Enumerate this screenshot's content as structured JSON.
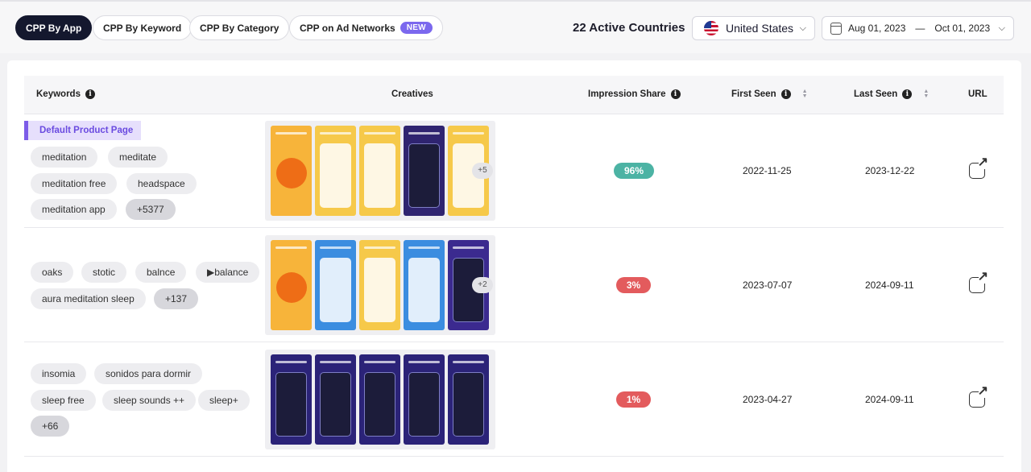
{
  "tabs": [
    {
      "label": "CPP By App"
    },
    {
      "label": "CPP By Keyword"
    },
    {
      "label": "CPP By Category"
    },
    {
      "label": "CPP on Ad Networks",
      "badge": "NEW"
    }
  ],
  "countries_label": "22 Active Countries",
  "country": "United States",
  "date_range": {
    "start": "Aug 01, 2023",
    "separator": "—",
    "end": "Oct 01, 2023"
  },
  "columns": {
    "keywords": "Keywords",
    "creatives": "Creatives",
    "impression_share": "Impression Share",
    "first_seen": "First Seen",
    "last_seen": "Last Seen",
    "url": "URL"
  },
  "rows": [
    {
      "badge": "Default Product Page",
      "keywords": [
        "meditation",
        "meditate",
        "meditation free",
        "headspace",
        "meditation app"
      ],
      "more_keywords": "+5377",
      "more_creatives": "+5",
      "impression_share": "96%",
      "first_seen": "2022-11-25",
      "last_seen": "2023-12-22",
      "creative_colors": [
        "#f7b43a",
        "#f6c94a",
        "#f6c94a",
        "#2f2470",
        "#f6c94a"
      ]
    },
    {
      "keywords": [
        "oaks",
        "stotic",
        "balnce",
        "▶balance",
        "aura meditation sleep"
      ],
      "more_keywords": "+137",
      "more_creatives": "+2",
      "impression_share": "3%",
      "first_seen": "2023-07-07",
      "last_seen": "2024-09-11",
      "creative_colors": [
        "#f7b43a",
        "#3b8de0",
        "#f6c94a",
        "#3b8de0",
        "#3b2a8f"
      ]
    },
    {
      "keywords": [
        "insomia",
        "sonidos para dormir",
        "sleep free",
        "sleep sounds ++",
        "sleep+"
      ],
      "more_keywords": "+66",
      "impression_share": "1%",
      "first_seen": "2023-04-27",
      "last_seen": "2024-09-11",
      "creative_colors": [
        "#2b2378",
        "#2b2378",
        "#2b2378",
        "#2b2378",
        "#2b2378"
      ]
    }
  ]
}
